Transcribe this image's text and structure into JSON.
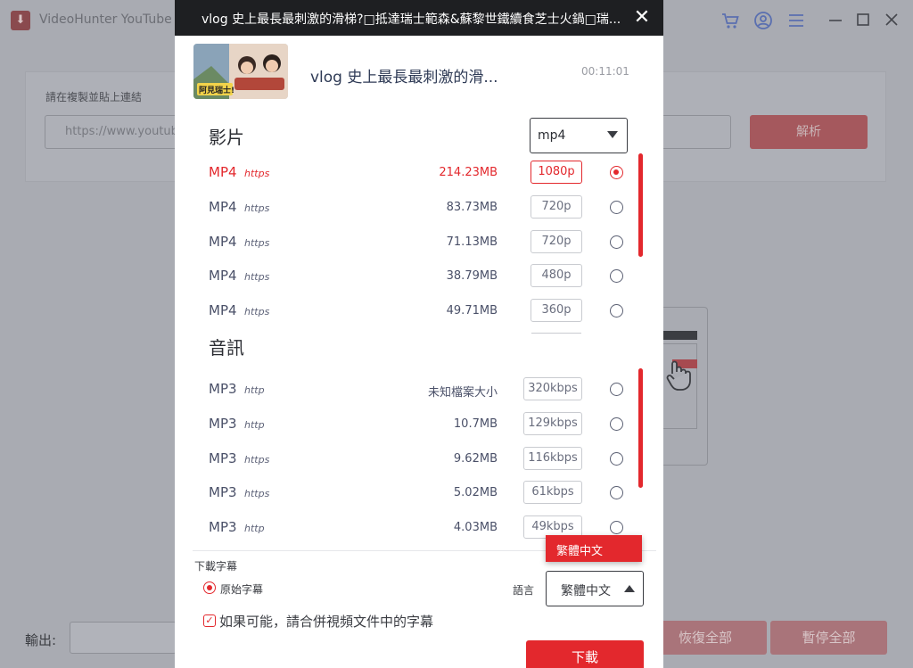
{
  "app": {
    "logo_glyph": "⬇",
    "title": "VideoHunter YouTube D",
    "url_label": "請在複製並貼上連結",
    "url_value": "https://www.youtub",
    "parse_label": "解析",
    "output_label": "輸出:",
    "resume_all": "恢復全部",
    "pause_all": "暫停全部",
    "icons": [
      "cart-icon",
      "user-icon",
      "menu-icon"
    ],
    "window_controls": [
      "minimize-icon",
      "maximize-icon",
      "close-icon"
    ]
  },
  "modal": {
    "title": "vlog 史上最長最刺激的滑梯?□抵達瑞士範森&蘇黎世鐵續食芝士火鍋□瑞...",
    "close_glyph": "✕",
    "video_name": "vlog 史上最長最刺激的滑...",
    "duration": "00:11:01",
    "thumbnail_caption": "阿見瑞士!",
    "video_section": "影片",
    "format_value": "mp4",
    "video_rows": [
      {
        "format": "MP4",
        "protocol": "https",
        "size": "214.23MB",
        "quality": "1080p",
        "selected": true
      },
      {
        "format": "MP4",
        "protocol": "https",
        "size": "83.73MB",
        "quality": "720p",
        "selected": false
      },
      {
        "format": "MP4",
        "protocol": "https",
        "size": "71.13MB",
        "quality": "720p",
        "selected": false
      },
      {
        "format": "MP4",
        "protocol": "https",
        "size": "38.79MB",
        "quality": "480p",
        "selected": false
      },
      {
        "format": "MP4",
        "protocol": "https",
        "size": "49.71MB",
        "quality": "360p",
        "selected": false
      }
    ],
    "audio_section": "音訊",
    "audio_rows": [
      {
        "format": "MP3",
        "protocol": "http",
        "size": "未知檔案大小",
        "quality": "320kbps",
        "selected": false
      },
      {
        "format": "MP3",
        "protocol": "http",
        "size": "10.7MB",
        "quality": "129kbps",
        "selected": false
      },
      {
        "format": "MP3",
        "protocol": "https",
        "size": "9.62MB",
        "quality": "116kbps",
        "selected": false
      },
      {
        "format": "MP3",
        "protocol": "https",
        "size": "5.02MB",
        "quality": "61kbps",
        "selected": false
      },
      {
        "format": "MP3",
        "protocol": "http",
        "size": "4.03MB",
        "quality": "49kbps",
        "selected": false
      }
    ],
    "subtitle_label": "下載字幕",
    "original_subtitle": "原始字幕",
    "language_label": "語言",
    "language_value": "繁體中文",
    "language_menu_item": "繁體中文",
    "merge_label": "如果可能，請合併視頻文件中的字幕",
    "download_label": "下載"
  },
  "colors": {
    "accent": "#e3282d",
    "header_bg": "#1e1f22",
    "overlay_bg": "#a9abb2"
  }
}
